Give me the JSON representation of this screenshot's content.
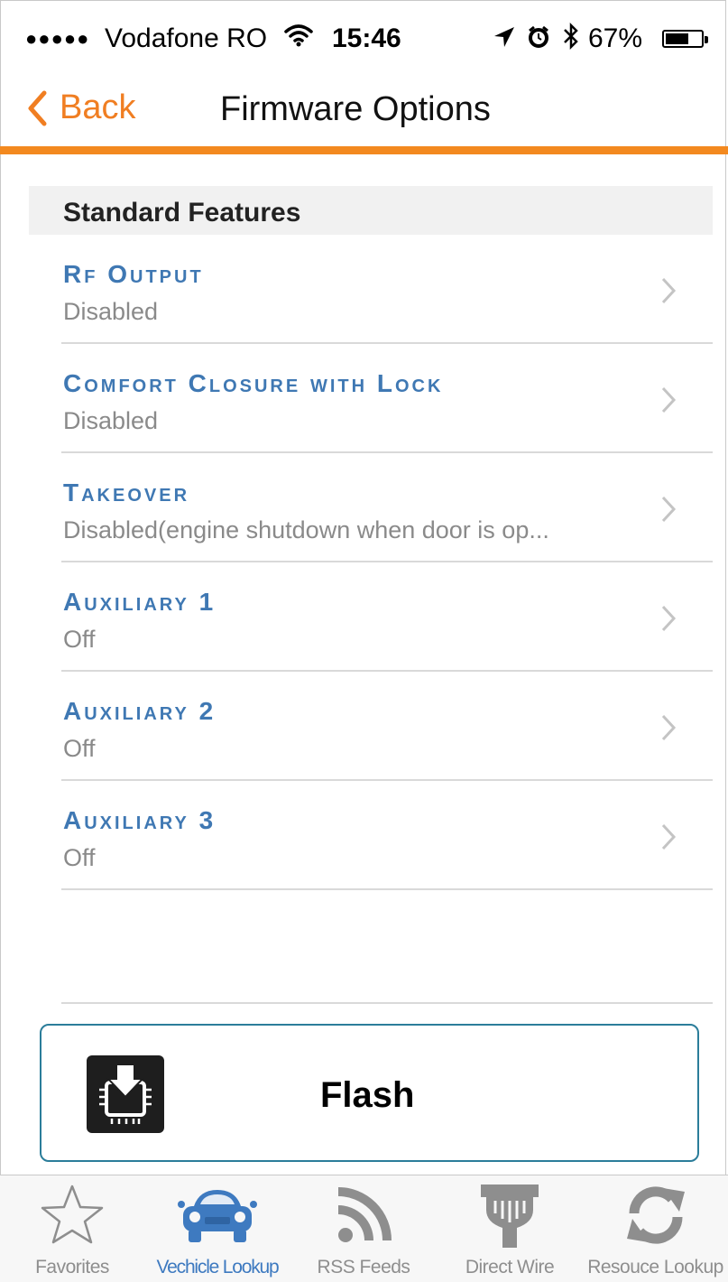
{
  "status_bar": {
    "signal": "●●●●●",
    "carrier": "Vodafone RO",
    "time": "15:46",
    "battery_percent": "67%",
    "battery_level": 0.67,
    "icons": [
      "wifi-icon",
      "location-arrow-icon",
      "alarm-icon",
      "bluetooth-icon",
      "battery-icon"
    ]
  },
  "nav": {
    "back_label": "Back",
    "title": "Firmware Options"
  },
  "colors": {
    "accent_orange": "#f07e22",
    "rule_orange": "#f3891f",
    "title_blue": "#3f78b3",
    "active_tab_blue": "#3e7ac0",
    "button_border": "#2b7d9a"
  },
  "section": {
    "header": "Standard Features"
  },
  "items": [
    {
      "title": "Rf Output",
      "value": "Disabled"
    },
    {
      "title": "Comfort Closure with Lock",
      "value": "Disabled"
    },
    {
      "title": "Takeover",
      "value": "Disabled(engine shutdown when door is op..."
    },
    {
      "title": "Auxiliary 1",
      "value": "Off"
    },
    {
      "title": "Auxiliary 2",
      "value": "Off"
    },
    {
      "title": "Auxiliary 3",
      "value": "Off"
    }
  ],
  "flash_button": {
    "label": "Flash",
    "icon": "chip-download-icon"
  },
  "tabs": [
    {
      "label": "Favorites",
      "icon": "star-icon",
      "active": false
    },
    {
      "label": "Vechicle Lookup",
      "icon": "car-icon",
      "active": true
    },
    {
      "label": "RSS Feeds",
      "icon": "rss-icon",
      "active": false
    },
    {
      "label": "Direct Wire",
      "icon": "wire-icon",
      "active": false
    },
    {
      "label": "Resouce Lookup",
      "icon": "refresh-icon",
      "active": false
    }
  ]
}
